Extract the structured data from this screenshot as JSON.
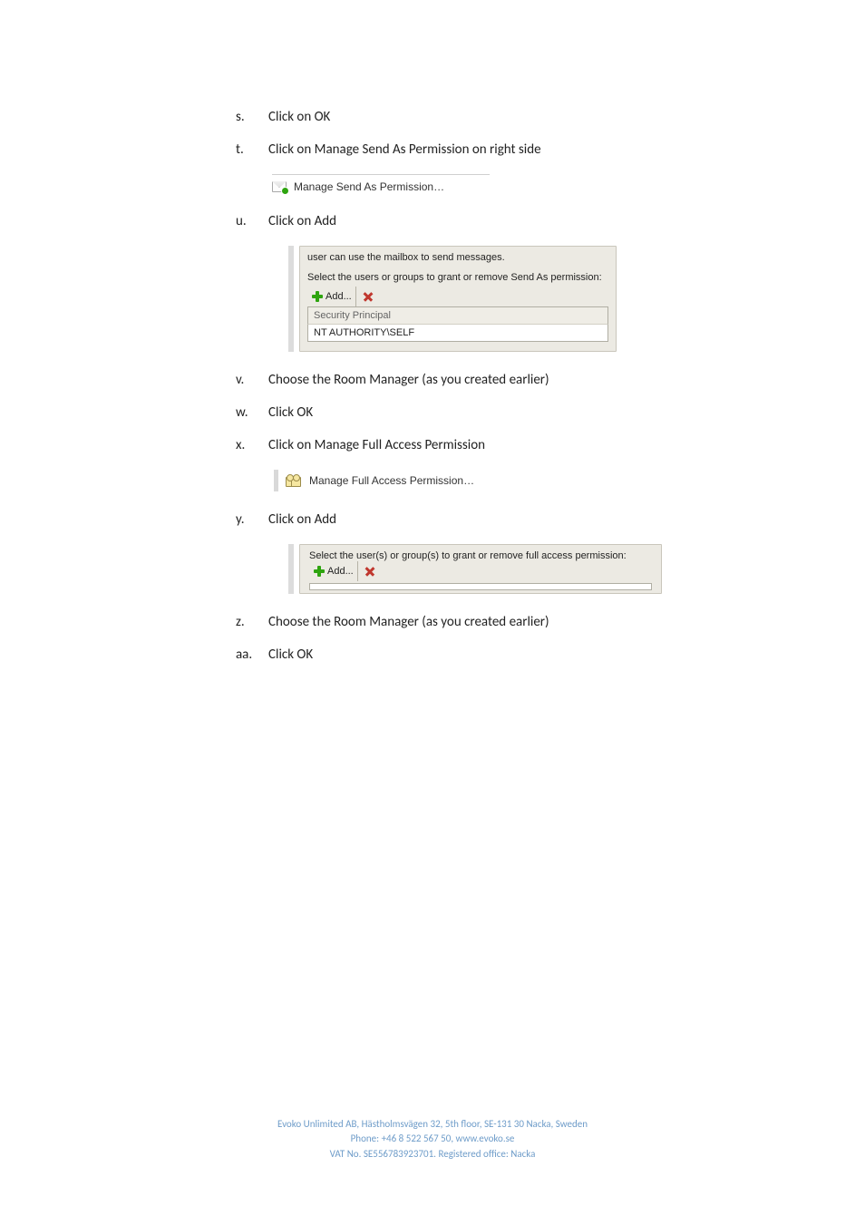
{
  "steps": {
    "s": {
      "marker": "s.",
      "text": "Click on OK"
    },
    "t": {
      "marker": "t.",
      "text": "Click on Manage Send As Permission on right side"
    },
    "u": {
      "marker": "u.",
      "text": "Click on Add"
    },
    "v": {
      "marker": "v.",
      "text": "Choose the Room Manager (as you created earlier)"
    },
    "w": {
      "marker": "w.",
      "text": "Click OK"
    },
    "x": {
      "marker": "x.",
      "text": "Click on Manage Full Access Permission"
    },
    "y": {
      "marker": "y.",
      "text": "Click on Add"
    },
    "z": {
      "marker": "z.",
      "text": "Choose the Room Manager (as you created earlier)"
    },
    "aa": {
      "marker": "aa.",
      "text": "Click OK"
    }
  },
  "shots": {
    "send_as_link": "Manage Send As Permission…",
    "send_as_panel": {
      "line1": "user can use the mailbox to send messages.",
      "line2": "Select the users or groups to grant or remove Send As permission:",
      "add_label": "Add...",
      "col_header": "Security Principal",
      "row1": "NT AUTHORITY\\SELF"
    },
    "full_access_link": "Manage Full Access Permission…",
    "full_access_panel": {
      "line1": "Select the user(s) or group(s) to grant or remove full access permission:",
      "add_label": "Add..."
    }
  },
  "footer": {
    "line1": "Evoko Unlimited AB,  Hästholmsvägen 32, 5th floor, SE-131 30 Nacka, Sweden",
    "line2": "Phone: +46 8 522 567 50,  www.evoko.se",
    "line3": "VAT No. SE556783923701. Registered office: Nacka"
  }
}
